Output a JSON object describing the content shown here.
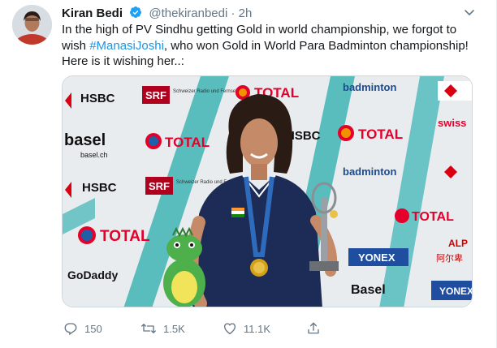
{
  "author": {
    "name": "Kiran Bedi",
    "handle": "@thekiranbedi",
    "separator": "·",
    "time": "2h",
    "verified": true
  },
  "tweet": {
    "text_before": "In the high of PV Sindhu getting Gold in world championship, we forgot to wish ",
    "hashtag": "#ManasiJoshi",
    "text_after": ", who won Gold in World Para Badminton championship! Here is it wishing her..:"
  },
  "photo": {
    "logos": [
      "HSBC",
      "SRF",
      "Schweizer Radio und Fernsehen",
      "TOTAL",
      "badminton",
      "swiss",
      "basel",
      "basel.ch",
      "GoDaddy",
      "YONEX",
      "Basel",
      "ALP",
      "阿尔卑"
    ]
  },
  "actions": {
    "replies": "150",
    "retweets": "1.5K",
    "likes": "11.1K"
  },
  "colors": {
    "accent": "#1b95e0",
    "secondary_text": "#657786",
    "backdrop_teal": "#3fb5b5",
    "shirt_navy": "#1c2c57"
  }
}
